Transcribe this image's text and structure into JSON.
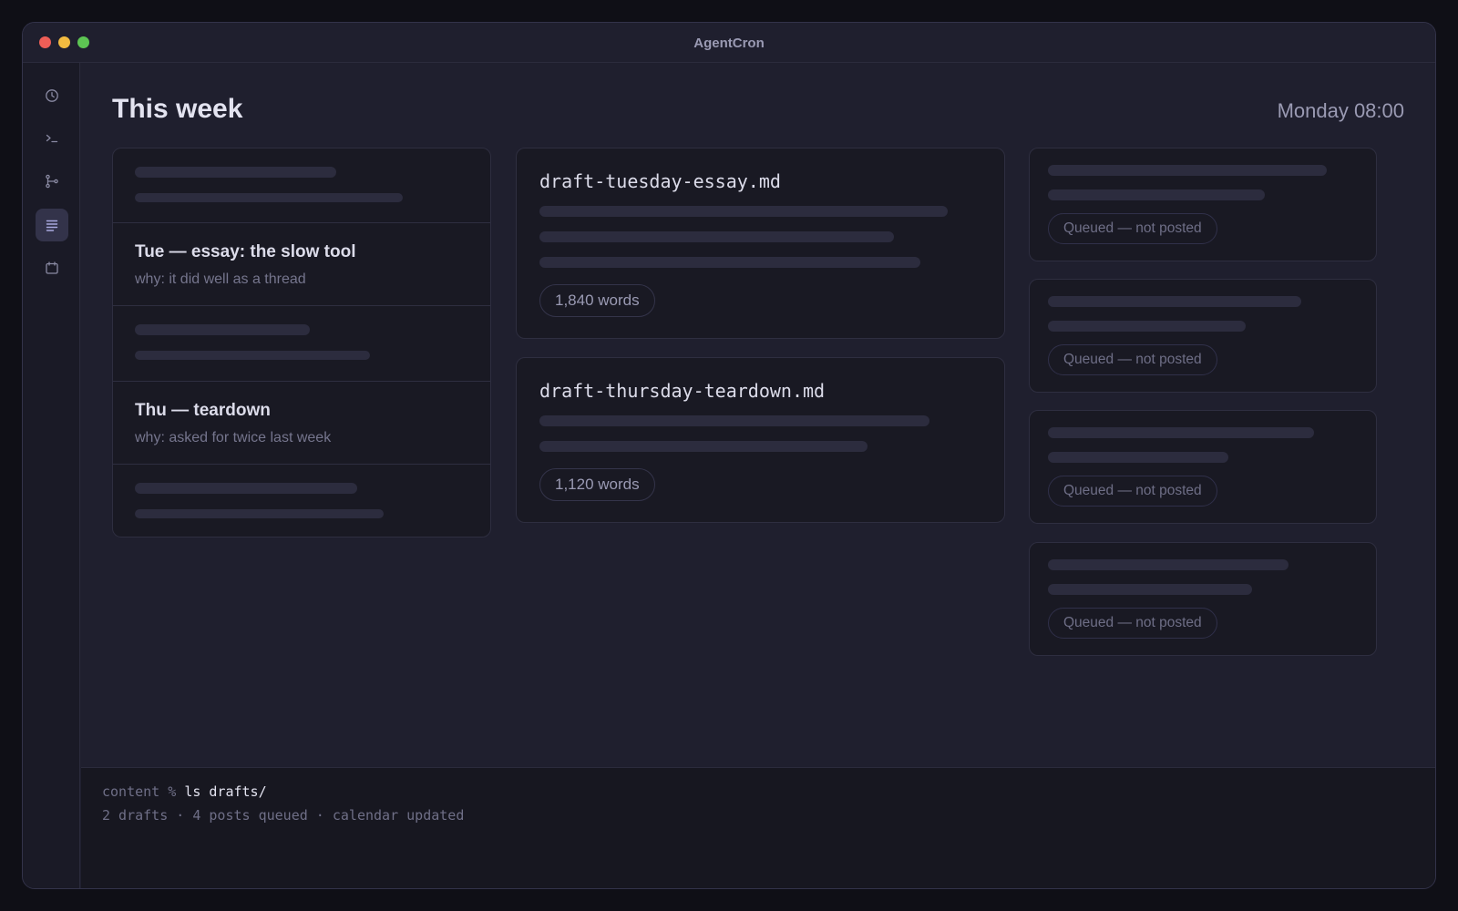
{
  "window": {
    "title": "AgentCron"
  },
  "sidebar": {
    "items": [
      {
        "icon": "clock-icon",
        "active": false
      },
      {
        "icon": "terminal-icon",
        "active": false
      },
      {
        "icon": "branch-icon",
        "active": false
      },
      {
        "icon": "list-icon",
        "active": true
      },
      {
        "icon": "calendar-icon",
        "active": false
      }
    ]
  },
  "header": {
    "title": "This week",
    "time": "Monday 08:00"
  },
  "plan": {
    "items": [
      {
        "title": "Tue — essay: the slow tool",
        "reason": "why: it did well as a thread"
      },
      {
        "title": "Thu — teardown",
        "reason": "why: asked for twice last week"
      }
    ]
  },
  "drafts": [
    {
      "filename": "draft-tuesday-essay.md",
      "words": "1,840 words"
    },
    {
      "filename": "draft-thursday-teardown.md",
      "words": "1,120 words"
    }
  ],
  "queue": [
    {
      "status": "Queued — not posted"
    },
    {
      "status": "Queued — not posted"
    },
    {
      "status": "Queued — not posted"
    },
    {
      "status": "Queued — not posted"
    }
  ],
  "terminal": {
    "prompt": "content %",
    "command": "ls drafts/",
    "output": "2 drafts · 4 posts queued · calendar updated"
  },
  "colors": {
    "background": "#1f1f2e",
    "card": "#191923",
    "active": "#33334a"
  }
}
